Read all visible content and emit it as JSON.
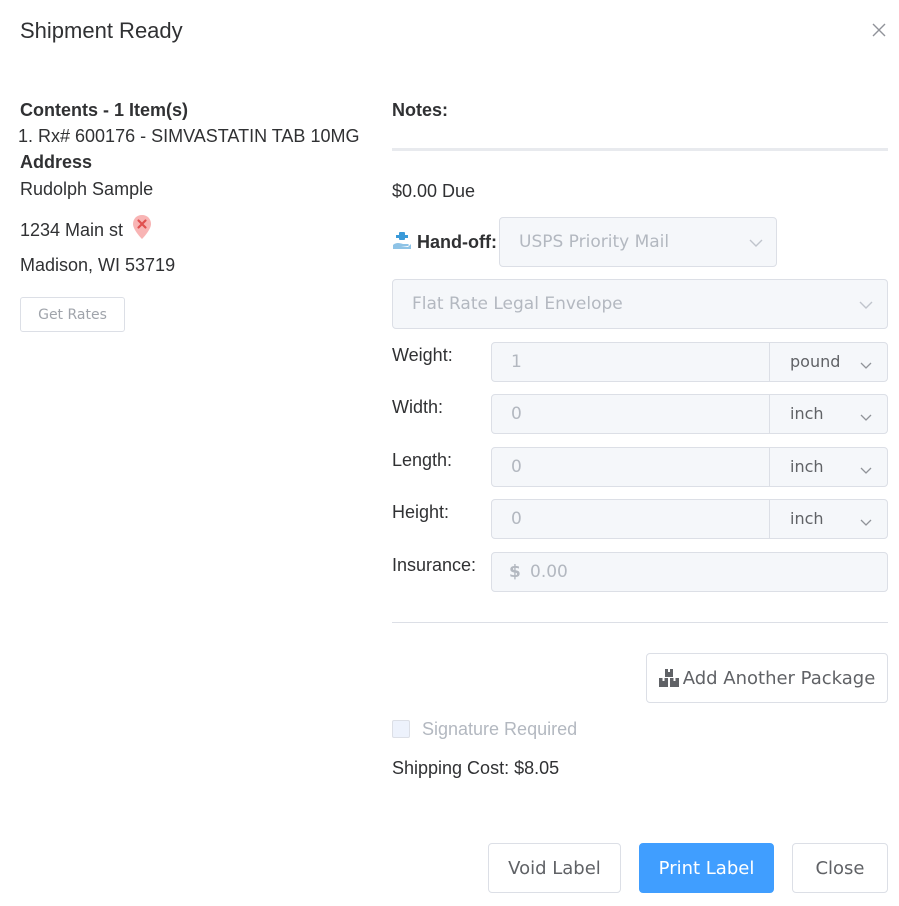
{
  "modal": {
    "title": "Shipment Ready",
    "close_icon": "close-icon"
  },
  "left": {
    "contents_heading": "Contents - 1 Item(s)",
    "items": [
      "1. Rx# 600176 - SIMVASTATIN TAB 10MG"
    ],
    "address_heading": "Address",
    "name": "Rudolph Sample",
    "street": "1234 Main st",
    "address_status_icon": "map-pin-x-icon",
    "address_status_color": "#f56c6c",
    "city_line": "Madison, WI 53719",
    "get_rates_label": "Get Rates"
  },
  "right": {
    "notes_label": "Notes:",
    "due": "$0.00 Due",
    "handoff_icon": "hand-off-icon",
    "handoff_label": "Hand-off:",
    "handoff_value": "USPS Priority Mail",
    "package_value": "Flat Rate Legal Envelope",
    "weight": {
      "label": "Weight:",
      "value": "1",
      "unit": "pound"
    },
    "width": {
      "label": "Width:",
      "value": "0",
      "unit": "inch"
    },
    "length": {
      "label": "Length:",
      "value": "0",
      "unit": "inch"
    },
    "height": {
      "label": "Height:",
      "value": "0",
      "unit": "inch"
    },
    "insurance": {
      "label": "Insurance:",
      "prefix": "$",
      "value": "0.00"
    },
    "add_package_label": "Add Another Package",
    "add_package_icon": "boxes-icon",
    "signature_label": "Signature Required",
    "signature_checked": false,
    "shipping_cost": "Shipping Cost: $8.05"
  },
  "footer": {
    "void_label": "Void Label",
    "print_label": "Print Label",
    "close_label": "Close"
  },
  "colors": {
    "primary": "#409eff",
    "text": "#303133",
    "disabled_text": "#b3b8c0"
  }
}
